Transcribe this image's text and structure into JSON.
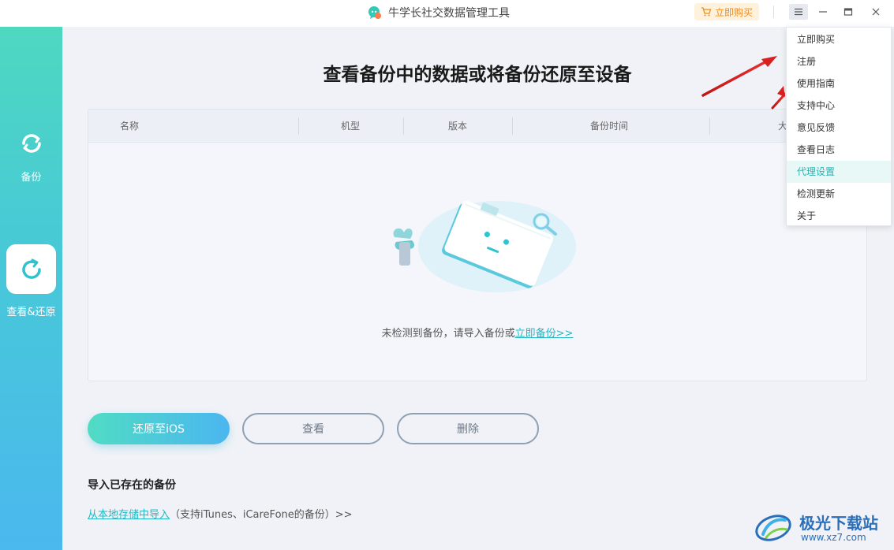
{
  "titlebar": {
    "app_title": "牛学长社交数据管理工具",
    "buy_label": "立即购买"
  },
  "sidebar": {
    "items": [
      {
        "label": "备份"
      },
      {
        "label": "查看&还原"
      }
    ]
  },
  "main": {
    "page_title": "查看备份中的数据或将备份还原至设备",
    "table": {
      "columns": [
        "名称",
        "机型",
        "版本",
        "备份时间",
        "大"
      ]
    },
    "empty": {
      "text": "未检测到备份，请导入备份或",
      "link": "立即备份>>"
    },
    "buttons": {
      "restore": "还原至iOS",
      "view": "查看",
      "delete": "删除"
    },
    "import": {
      "title": "导入已存在的备份",
      "link": "从本地存储中导入",
      "note": "（支持iTunes、iCareFone的备份）>>"
    }
  },
  "dropdown": {
    "items": [
      "立即购买",
      "注册",
      "使用指南",
      "支持中心",
      "意见反馈",
      "查看日志",
      "代理设置",
      "检测更新",
      "关于"
    ],
    "highlighted": "代理设置"
  },
  "watermark": {
    "name": "极光下载站",
    "url": "www.xz7.com"
  },
  "colors": {
    "accent": "#22b8c4",
    "sidebar_top": "#4ed8c0",
    "sidebar_bottom": "#4bb8ee",
    "buy": "#f08a1b"
  }
}
